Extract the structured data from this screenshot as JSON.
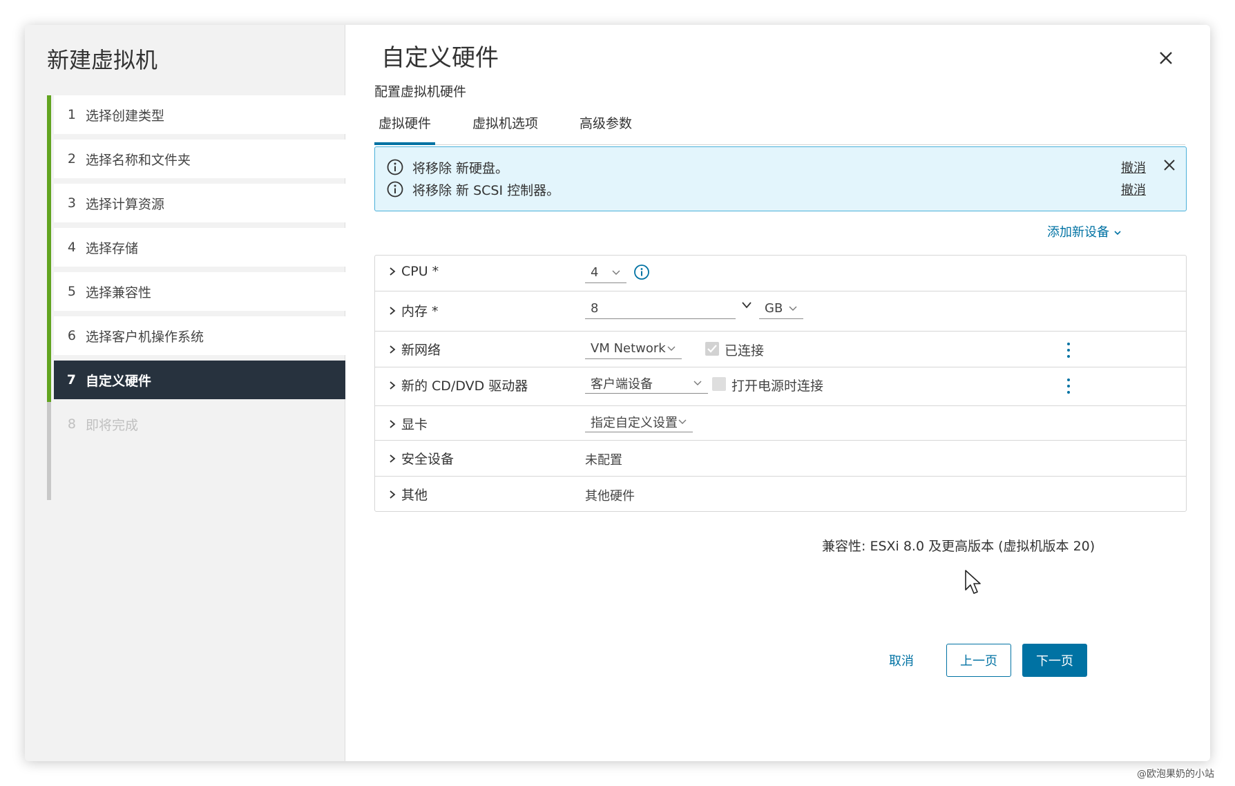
{
  "sidebar": {
    "title": "新建虚拟机",
    "steps": [
      {
        "num": "1",
        "label": "选择创建类型"
      },
      {
        "num": "2",
        "label": "选择名称和文件夹"
      },
      {
        "num": "3",
        "label": "选择计算资源"
      },
      {
        "num": "4",
        "label": "选择存储"
      },
      {
        "num": "5",
        "label": "选择兼容性"
      },
      {
        "num": "6",
        "label": "选择客户机操作系统"
      },
      {
        "num": "7",
        "label": "自定义硬件"
      },
      {
        "num": "8",
        "label": "即将完成"
      }
    ]
  },
  "main": {
    "title": "自定义硬件",
    "subtitle": "配置虚拟机硬件",
    "tabs": [
      "虚拟硬件",
      "虚拟机选项",
      "高级参数"
    ],
    "alert": {
      "messages": [
        "将移除 新硬盘。",
        "将移除 新 SCSI 控制器。"
      ],
      "undo_label": "撤消"
    },
    "add_device": "添加新设备",
    "hardware": {
      "cpu": {
        "label": "CPU *",
        "value": "4"
      },
      "memory": {
        "label": "内存 *",
        "value": "8",
        "unit": "GB"
      },
      "network": {
        "label": "新网络",
        "value": "VM Network",
        "connected_label": "已连接"
      },
      "cddvd": {
        "label": "新的 CD/DVD 驱动器",
        "value": "客户端设备",
        "power_on_label": "打开电源时连接"
      },
      "video": {
        "label": "显卡",
        "value": "指定自定义设置"
      },
      "security": {
        "label": "安全设备",
        "value": "未配置"
      },
      "other": {
        "label": "其他",
        "value": "其他硬件"
      }
    },
    "compatibility": "兼容性: ESXi 8.0 及更高版本 (虚拟机版本 20)",
    "buttons": {
      "cancel": "取消",
      "prev": "上一页",
      "next": "下一页"
    }
  },
  "watermark": "@欧泡果奶的小站",
  "colors": {
    "accent": "#0072a3",
    "progress": "#62a420",
    "active_step": "#27323e",
    "alert_bg": "#e3f5fc"
  }
}
